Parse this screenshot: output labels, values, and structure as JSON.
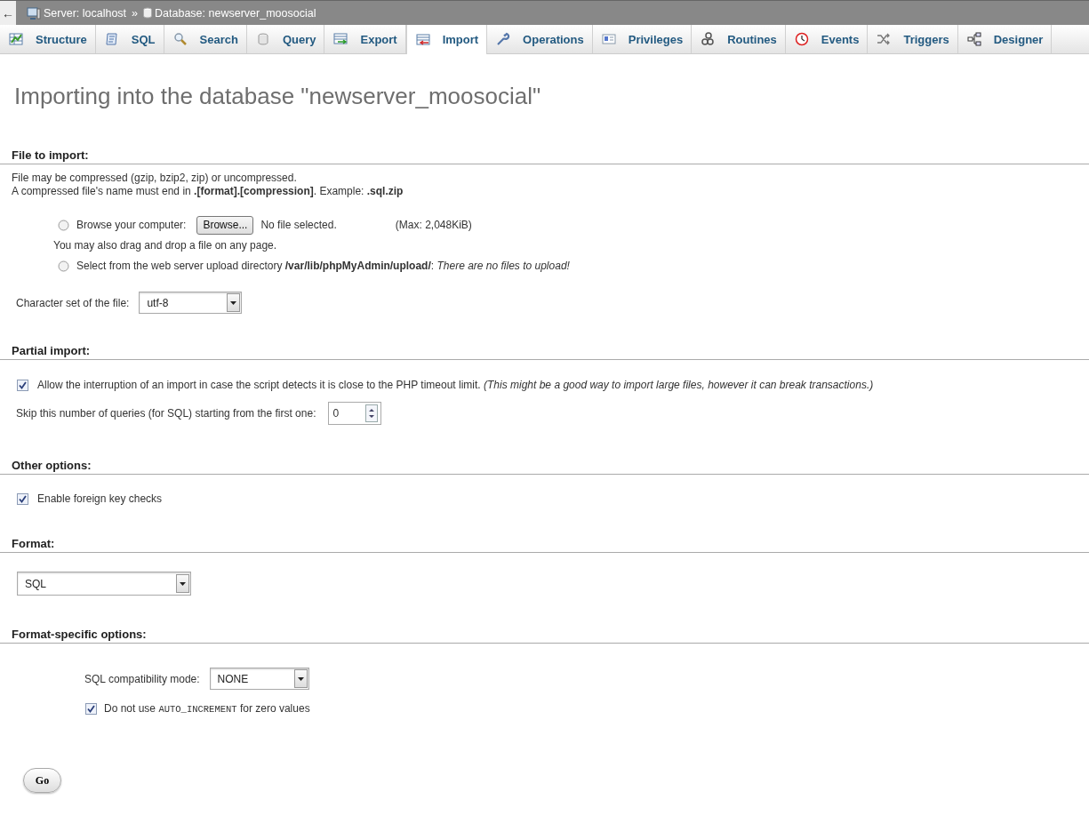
{
  "breadcrumb": {
    "back": "←",
    "server": "Server: localhost",
    "separator": "»",
    "database": "Database: newserver_moosocial"
  },
  "tabs": [
    {
      "label": "Structure",
      "kind": "structure",
      "selected": false
    },
    {
      "label": "SQL",
      "kind": "sql",
      "selected": false
    },
    {
      "label": "Search",
      "kind": "search",
      "selected": false
    },
    {
      "label": "Query",
      "kind": "query",
      "selected": false
    },
    {
      "label": "Export",
      "kind": "export",
      "selected": false
    },
    {
      "label": "Import",
      "kind": "import",
      "selected": true
    },
    {
      "label": "Operations",
      "kind": "operations",
      "selected": false
    },
    {
      "label": "Privileges",
      "kind": "privileges",
      "selected": false
    },
    {
      "label": "Routines",
      "kind": "routines",
      "selected": false
    },
    {
      "label": "Events",
      "kind": "events",
      "selected": false
    },
    {
      "label": "Triggers",
      "kind": "triggers",
      "selected": false
    },
    {
      "label": "Designer",
      "kind": "designer",
      "selected": false
    }
  ],
  "heading": "Importing into the database \"newserver_moosocial\"",
  "file_section": {
    "title": "File to import:",
    "note_1": "File may be compressed (gzip, bzip2, zip) or uncompressed.",
    "note_2": "A compressed file's name must end in **.[format].[compression]**. Example: **.sql.zip**",
    "sources": [
      {
        "kind": "upload",
        "selected": false,
        "label": "Browse your computer:",
        "button": "Browse...",
        "file_status": "No file selected.",
        "max": "(Max: 2,048KiB)",
        "hint": "You may also drag and drop a file on any page."
      },
      {
        "kind": "server",
        "selected": false,
        "label": "Select from the web server upload directory **/var/lib/phpMyAdmin/upload/**: *There are no files to upload!*"
      }
    ],
    "charset": {
      "label": "Character set of the file:",
      "value": "utf-8"
    }
  },
  "partial_section": {
    "title": "Partial import:",
    "allow_interrupt": {
      "checked": true,
      "label": "Allow the interruption of an import in case the script detects it is close to the PHP timeout limit. *(This might be a good way to import large files, however it can break transactions.)*"
    },
    "skip": {
      "label": "Skip this number of queries (for SQL) starting from the first one:",
      "value": "0"
    }
  },
  "other_section": {
    "title": "Other options:",
    "foreign_key_checks": {
      "checked": true,
      "label": "Enable foreign key checks"
    }
  },
  "format_section": {
    "title": "Format:",
    "value": "SQL"
  },
  "format_options": {
    "title": "Format-specific options:",
    "compat": {
      "label": "SQL compatibility mode:",
      "value": "NONE"
    },
    "no_auto_increment": {
      "checked": true,
      "before": "Do not use",
      "code": "AUTO_INCREMENT",
      "after": "for zero values"
    }
  },
  "go_button": "Go"
}
